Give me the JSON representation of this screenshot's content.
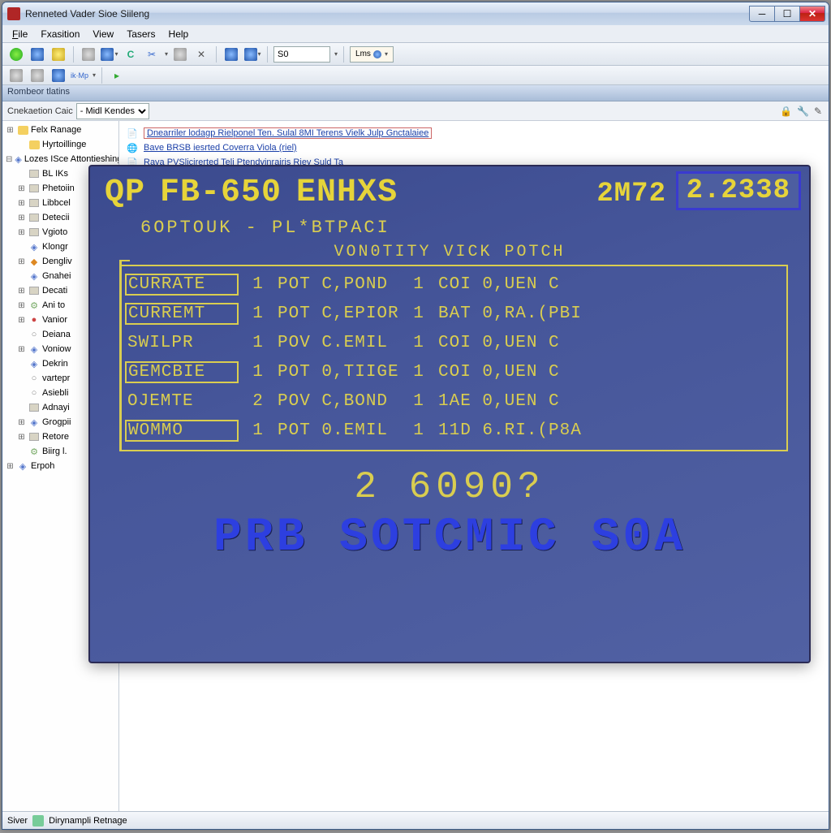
{
  "window": {
    "title": "Renneted Vader Sioe Siileng"
  },
  "menu": {
    "file": "File",
    "fxasition": "Fxasition",
    "view": "View",
    "tasers": "Tasers",
    "help": "Help"
  },
  "toolbar1": {
    "so_value": "S0",
    "pill": "Lms"
  },
  "panel_header": "Rombeor tlatins",
  "filter": {
    "label": "Cnekaetion Caic",
    "selected": "- Midl Kendes"
  },
  "tree": [
    {
      "label": "Felx Ranage",
      "lvl": 0,
      "tw": "+",
      "ic": "folder"
    },
    {
      "label": "Hyrtoillinge",
      "lvl": 1,
      "tw": "",
      "ic": "folder"
    },
    {
      "label": "Lozes ISce Attontieshing",
      "lvl": 0,
      "tw": "-",
      "ic": "blue"
    },
    {
      "label": "BL IKs",
      "lvl": 1,
      "tw": "",
      "ic": "box"
    },
    {
      "label": "Phetoiin",
      "lvl": 1,
      "tw": "+",
      "ic": "box"
    },
    {
      "label": "Libbcel",
      "lvl": 1,
      "tw": "+",
      "ic": "box"
    },
    {
      "label": "Detecii",
      "lvl": 1,
      "tw": "+",
      "ic": "box"
    },
    {
      "label": "Vgioto",
      "lvl": 1,
      "tw": "+",
      "ic": "box"
    },
    {
      "label": "Klongr",
      "lvl": 1,
      "tw": "",
      "ic": "blue"
    },
    {
      "label": "Dengliv",
      "lvl": 1,
      "tw": "+",
      "ic": "orange"
    },
    {
      "label": "Gnahei",
      "lvl": 1,
      "tw": "",
      "ic": "blue"
    },
    {
      "label": "Decati",
      "lvl": 1,
      "tw": "+",
      "ic": "box"
    },
    {
      "label": "Ani to",
      "lvl": 1,
      "tw": "+",
      "ic": "gear"
    },
    {
      "label": "Vanior",
      "lvl": 1,
      "tw": "+",
      "ic": "red"
    },
    {
      "label": "Deiana",
      "lvl": 1,
      "tw": "",
      "ic": "grey"
    },
    {
      "label": "Voniow",
      "lvl": 1,
      "tw": "+",
      "ic": "blue"
    },
    {
      "label": "Dekrin",
      "lvl": 1,
      "tw": "",
      "ic": "blue"
    },
    {
      "label": "vartepr",
      "lvl": 1,
      "tw": "",
      "ic": "grey"
    },
    {
      "label": "Asiebli",
      "lvl": 1,
      "tw": "",
      "ic": "grey"
    },
    {
      "label": "Adnayi",
      "lvl": 1,
      "tw": "",
      "ic": "box"
    },
    {
      "label": "Grogpii",
      "lvl": 1,
      "tw": "+",
      "ic": "blue"
    },
    {
      "label": "Retore",
      "lvl": 1,
      "tw": "+",
      "ic": "box"
    },
    {
      "label": "Biirg l.",
      "lvl": 1,
      "tw": "",
      "ic": "gear"
    },
    {
      "label": "Erpoh",
      "lvl": 0,
      "tw": "+",
      "ic": "blue"
    }
  ],
  "doc_links": {
    "l1": "Dnearriler lodagp Rielponel Ten. Sulal 8MI Terens Vielk Julp Gnctalaiee",
    "l2": "Bave BRSB iesrted Coverra Viola (riel)",
    "l3": "Rava PVSlicirerted Teli Ptendyinrairis Riey Suld Ta"
  },
  "terminal": {
    "prefix": "QP",
    "model": "FB-650",
    "brand": "ENHXS",
    "code": "2M72",
    "badge": "2.2338",
    "subtitle": "6OPTOUK - PL*BTPACI",
    "table_title": "VON0TITY VICK POTCH",
    "rows": [
      {
        "lab": "CURRATE",
        "n1": "1",
        "c2": "POT C,POND",
        "n2": "1",
        "c3": "COI 0,UEN C",
        "boxlab": true
      },
      {
        "lab": "CURREMT",
        "n1": "1",
        "c2": "POT C,EPIOR",
        "n2": "1",
        "c3": "BAT 0,RA.(PBI",
        "boxlab": true
      },
      {
        "lab": "SWILPR",
        "n1": "1",
        "c2": "POV C.EMIL",
        "n2": "1",
        "c3": "COI 0,UEN C",
        "boxlab": false
      },
      {
        "lab": "GEMCBIE",
        "n1": "1",
        "c2": "POT 0,TIIGE",
        "n2": "1",
        "c3": "COI 0,UEN C",
        "boxlab": true
      },
      {
        "lab": "OJEMTE",
        "n1": "2",
        "c2": "POV C,BOND",
        "n2": "1",
        "c3": "1AE 0,UEN C",
        "boxlab": false
      },
      {
        "lab": "WOMMO",
        "n1": "1",
        "c2": "POT 0.EMIL",
        "n2": "1",
        "c3": "11D 6.RI.(P8A",
        "boxlab": true
      }
    ],
    "bignum": "2 6090?",
    "logo": "PRB SOTCMIC S0A"
  },
  "status": {
    "left": "Siver",
    "right": "Dirynampli Retnage"
  }
}
